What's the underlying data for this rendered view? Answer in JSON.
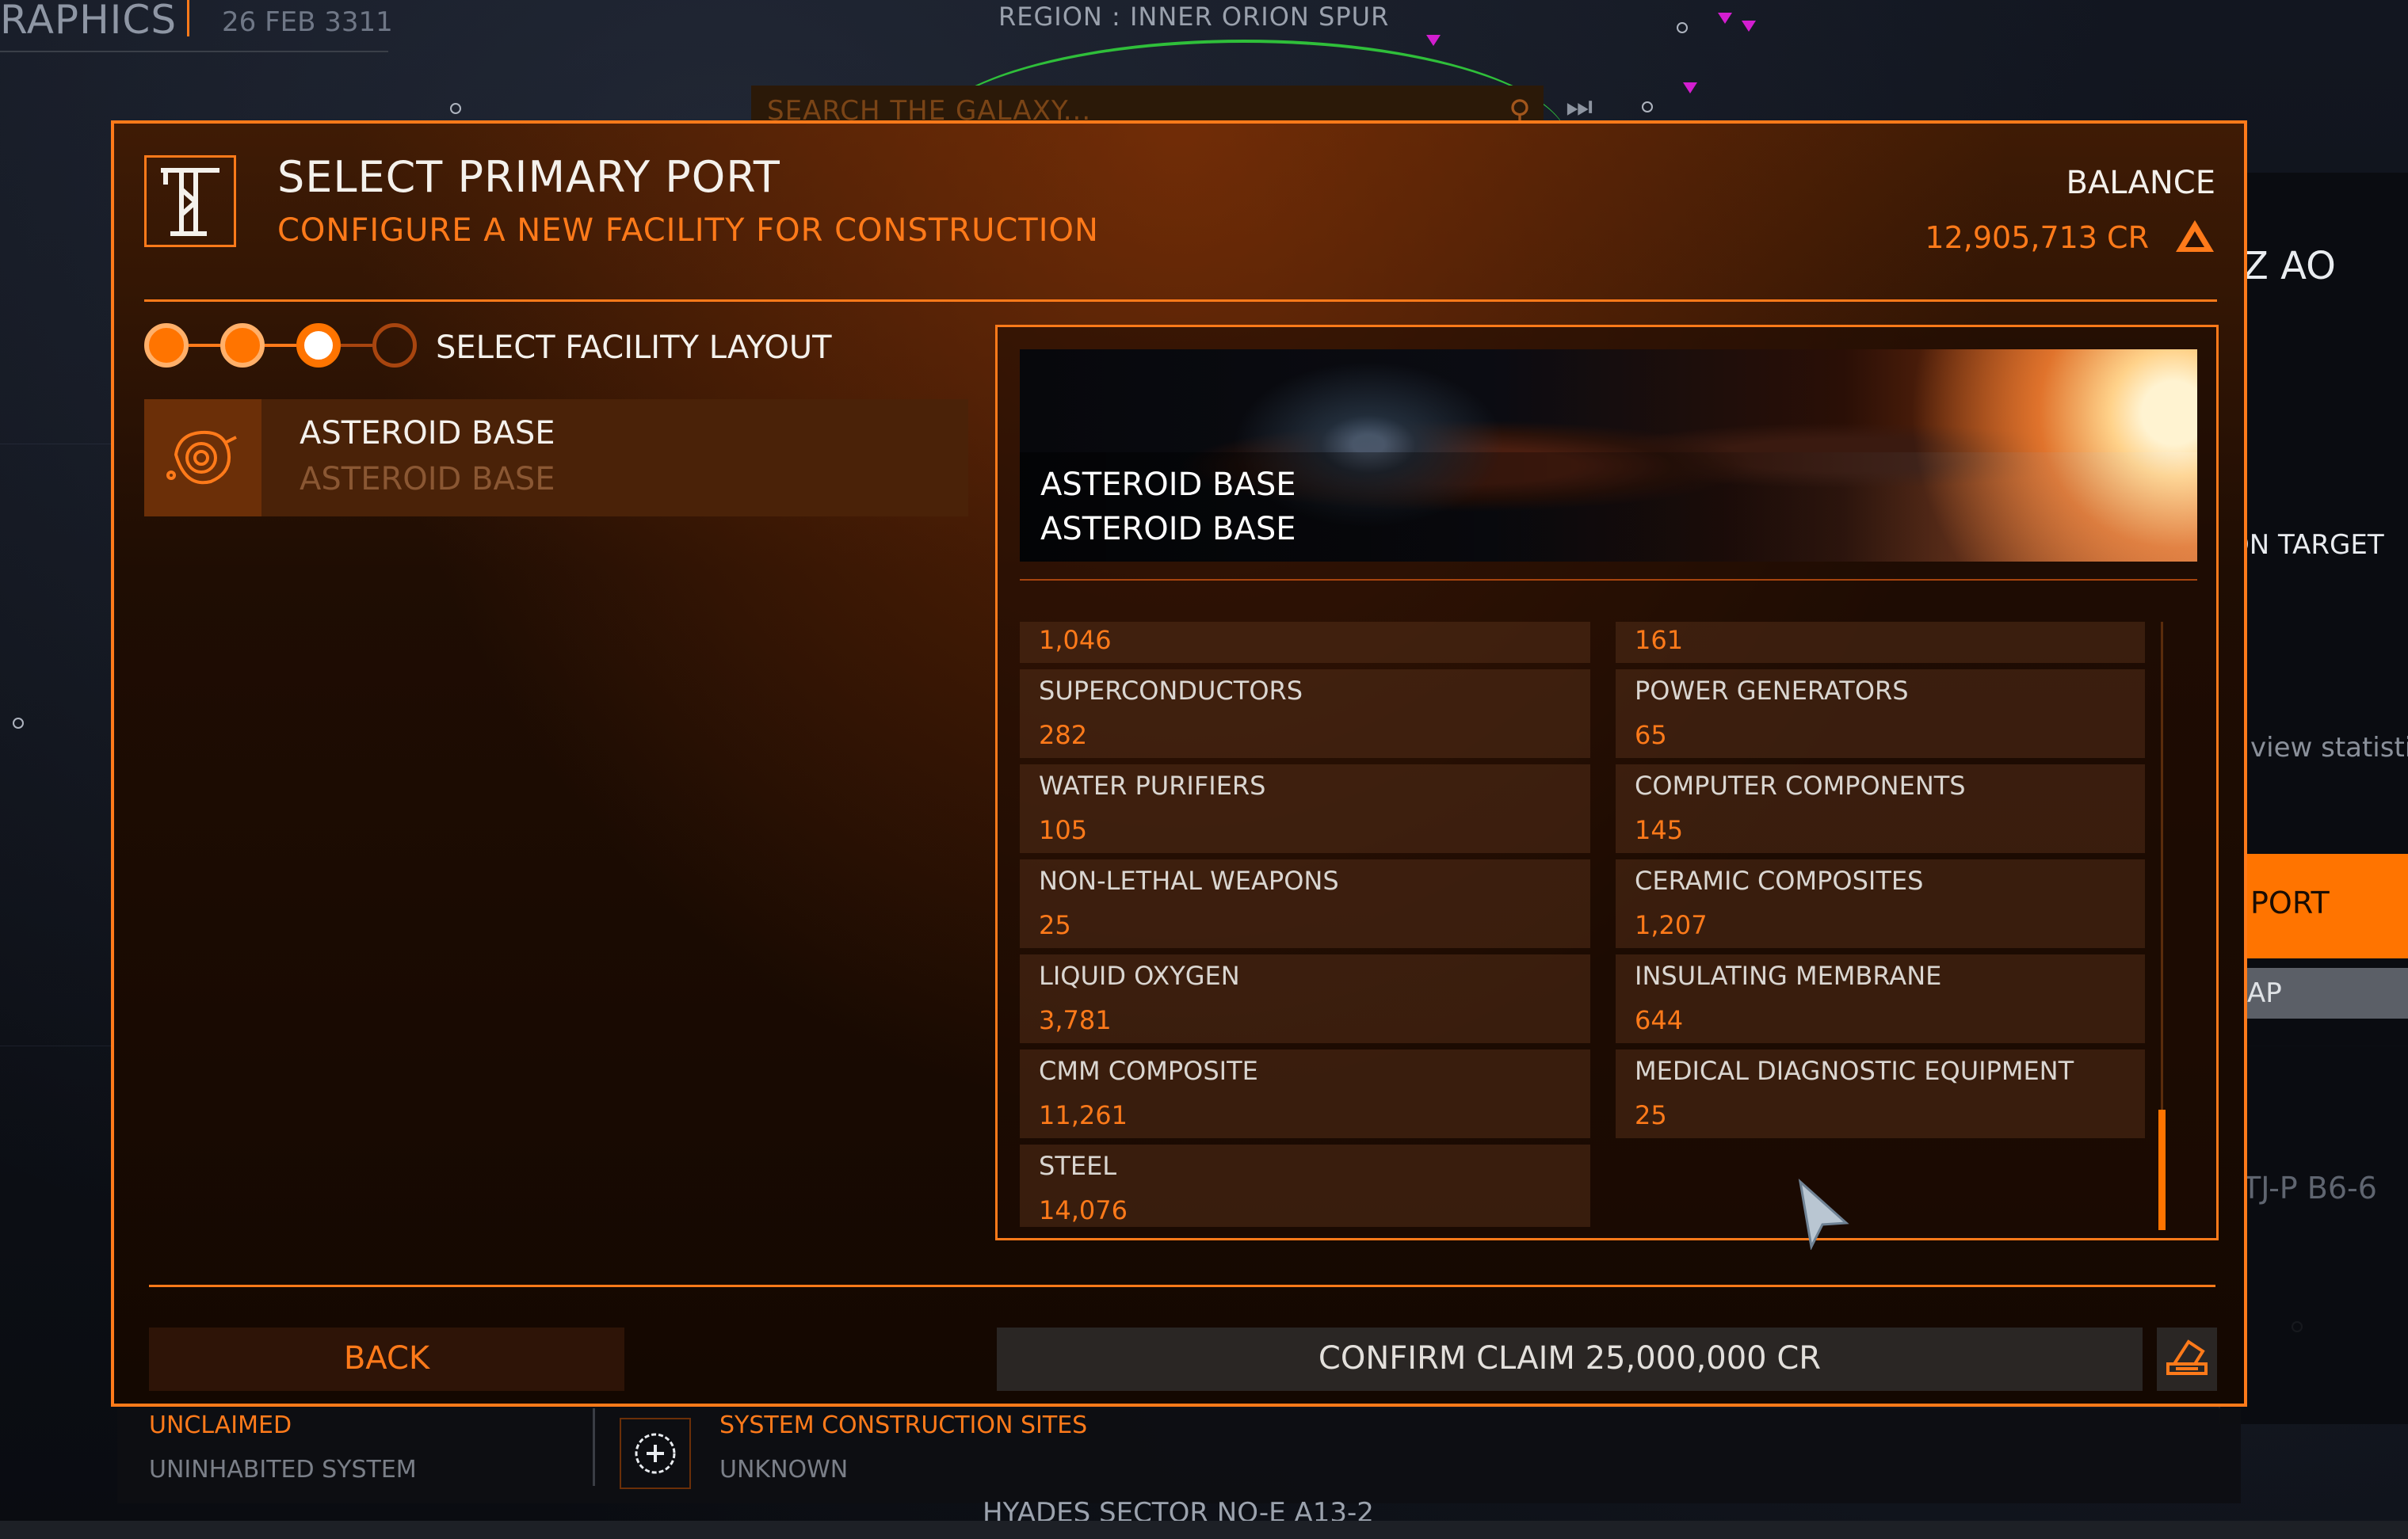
{
  "header": {
    "app_title_fragment": "RAPHICS",
    "date": "26 FEB 3311",
    "region": "REGION : INNER ORION SPUR"
  },
  "search": {
    "placeholder": "SEARCH THE GALAXY..."
  },
  "side_panel": {
    "title_fragment": "Z AO",
    "target_fragment": "ON TARGET",
    "stats_fragment": "view statisti",
    "port_button_fragment": "PORT",
    "map_button_fragment": "AP",
    "system_fragment": "TJ-P B6-6"
  },
  "modal": {
    "title": "SELECT PRIMARY PORT",
    "subtitle": "CONFIGURE A NEW FACILITY FOR CONSTRUCTION",
    "balance_label": "BALANCE",
    "balance_value": "12,905,713 CR",
    "steps": {
      "total": 4,
      "completed": 3,
      "current_label": "SELECT FACILITY LAYOUT"
    },
    "layout_option": {
      "name": "ASTEROID BASE",
      "type": "ASTEROID BASE"
    },
    "preview": {
      "name": "ASTEROID BASE",
      "type": "ASTEROID BASE"
    },
    "requirements": [
      {
        "name": "",
        "value": "1,046"
      },
      {
        "name": "",
        "value": "161"
      },
      {
        "name": "SUPERCONDUCTORS",
        "value": "282"
      },
      {
        "name": "POWER GENERATORS",
        "value": "65"
      },
      {
        "name": "WATER PURIFIERS",
        "value": "105"
      },
      {
        "name": "COMPUTER COMPONENTS",
        "value": "145"
      },
      {
        "name": "NON-LETHAL WEAPONS",
        "value": "25"
      },
      {
        "name": "CERAMIC COMPOSITES",
        "value": "1,207"
      },
      {
        "name": "LIQUID OXYGEN",
        "value": "3,781"
      },
      {
        "name": "INSULATING MEMBRANE",
        "value": "644"
      },
      {
        "name": "CMM COMPOSITE",
        "value": "11,261"
      },
      {
        "name": "MEDICAL DIAGNOSTIC EQUIPMENT",
        "value": "25"
      },
      {
        "name": "STEEL",
        "value": "14,076"
      }
    ],
    "back_label": "BACK",
    "confirm_label": "CONFIRM CLAIM 25,000,000 CR"
  },
  "bottom_panel": {
    "claim_status": "UNCLAIMED",
    "system_state": "UNINHABITED SYSTEM",
    "sites_label": "SYSTEM CONSTRUCTION SITES",
    "sites_value": "UNKNOWN"
  },
  "map_label": "HYADES SECTOR NO-E A13-2",
  "icons": {
    "port": "crane-icon",
    "credits": "credits-icon",
    "layout": "asteroid-icon",
    "search": "search-icon",
    "skip": "skip-end-icon",
    "add": "add-circle-icon",
    "confirm": "stamp-icon",
    "cursor": "pointer-cursor-icon"
  },
  "colors": {
    "accent": "#ff7a1a",
    "button_fill": "#ff7400",
    "text_light": "#f4f1ec"
  }
}
